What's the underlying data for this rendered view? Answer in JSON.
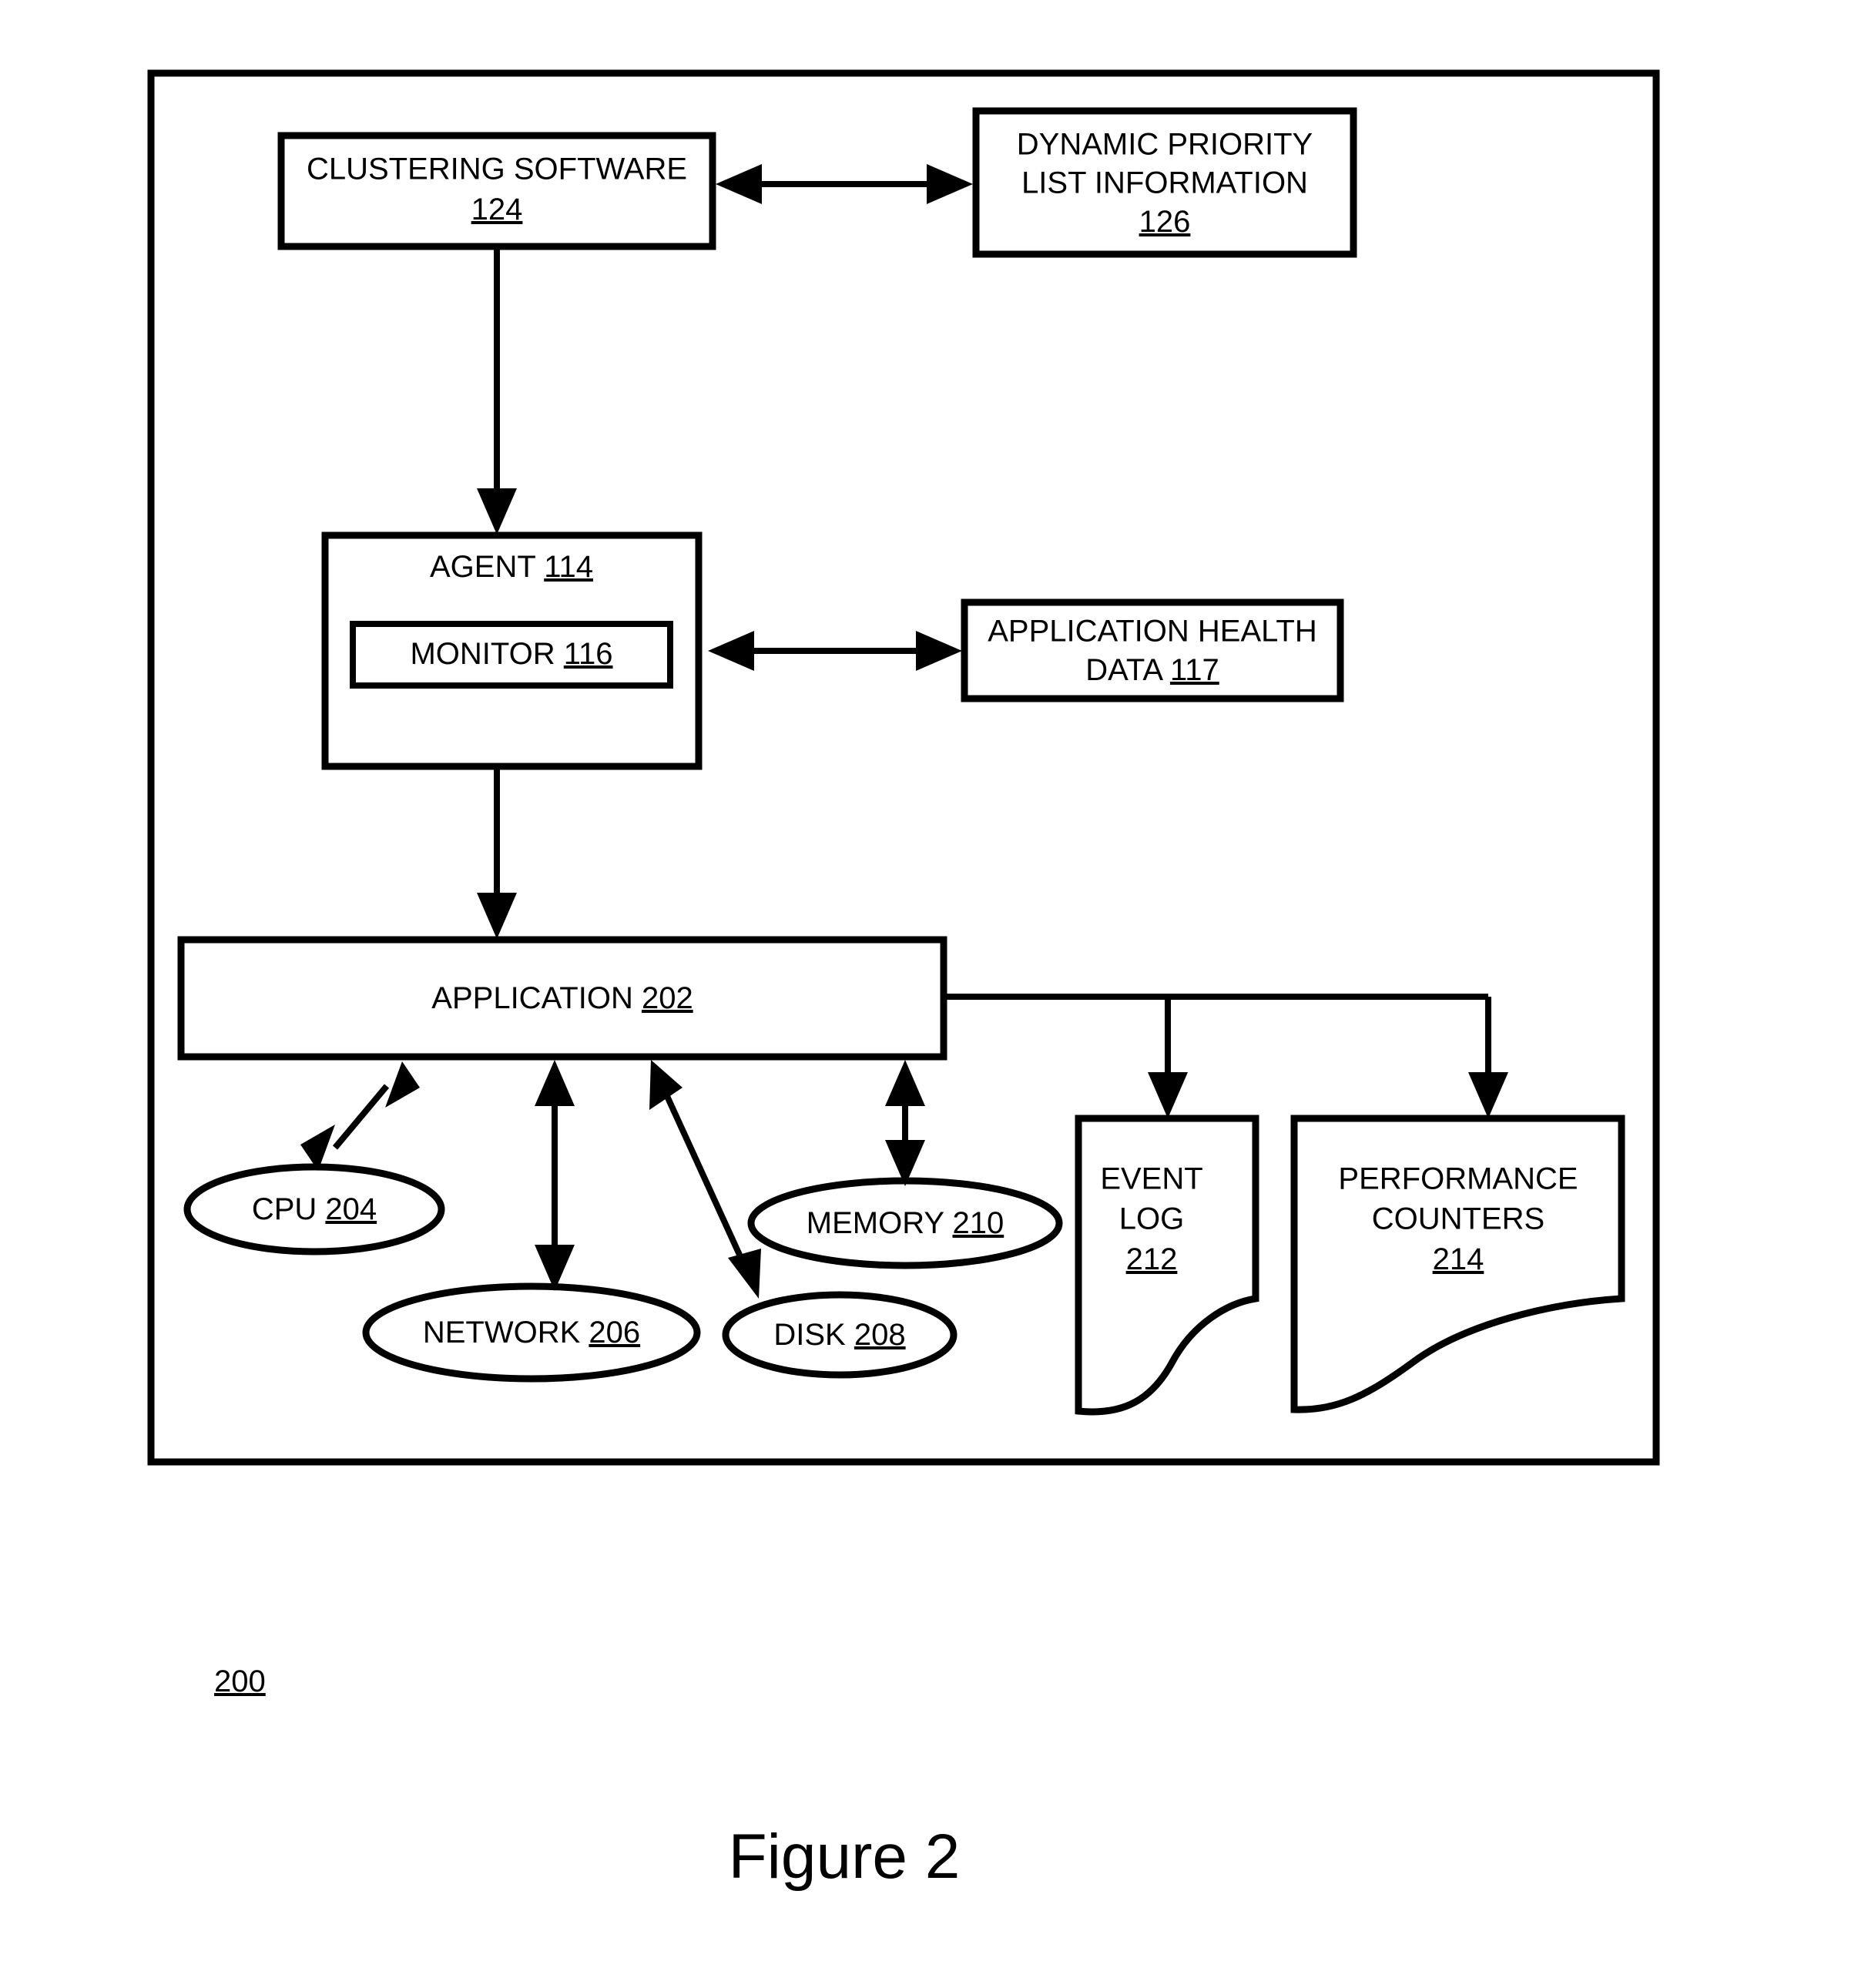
{
  "figure": {
    "caption": "Figure 2",
    "reference_number": "200"
  },
  "nodes": {
    "clustering_software": {
      "label": "CLUSTERING SOFTWARE",
      "ref": "124",
      "shape": "rectangle"
    },
    "dynamic_priority_list": {
      "label_line1": "DYNAMIC PRIORITY",
      "label_line2": "LIST INFORMATION",
      "ref": "126",
      "shape": "rectangle"
    },
    "agent": {
      "label": "AGENT",
      "ref": "114",
      "shape": "rectangle"
    },
    "monitor": {
      "label": "MONITOR",
      "ref": "116",
      "shape": "rectangle"
    },
    "application_health_data": {
      "label_line1": "APPLICATION HEALTH",
      "label_line2": "DATA",
      "ref": "117",
      "shape": "rectangle"
    },
    "application": {
      "label": "APPLICATION",
      "ref": "202",
      "shape": "rectangle"
    },
    "cpu": {
      "label": "CPU",
      "ref": "204",
      "shape": "ellipse"
    },
    "network": {
      "label": "NETWORK",
      "ref": "206",
      "shape": "ellipse"
    },
    "disk": {
      "label": "DISK",
      "ref": "208",
      "shape": "ellipse"
    },
    "memory": {
      "label": "MEMORY",
      "ref": "210",
      "shape": "ellipse"
    },
    "event_log": {
      "label_line1": "EVENT",
      "label_line2": "LOG",
      "ref": "212",
      "shape": "document"
    },
    "performance_counters": {
      "label_line1": "PERFORMANCE",
      "label_line2": "COUNTERS",
      "ref": "214",
      "shape": "document"
    }
  },
  "connections": [
    {
      "from": "clustering_software",
      "to": "dynamic_priority_list",
      "type": "bidirectional"
    },
    {
      "from": "clustering_software",
      "to": "agent",
      "type": "directional"
    },
    {
      "from": "monitor",
      "to": "application_health_data",
      "type": "bidirectional"
    },
    {
      "from": "agent",
      "to": "application",
      "type": "directional"
    },
    {
      "from": "application",
      "to": "cpu",
      "type": "bidirectional"
    },
    {
      "from": "application",
      "to": "network",
      "type": "bidirectional"
    },
    {
      "from": "application",
      "to": "disk",
      "type": "bidirectional"
    },
    {
      "from": "application",
      "to": "memory",
      "type": "bidirectional"
    },
    {
      "from": "application",
      "to": "event_log",
      "type": "directional"
    },
    {
      "from": "application",
      "to": "performance_counters",
      "type": "directional"
    }
  ],
  "colors": {
    "stroke": "#000000",
    "fill": "#ffffff"
  }
}
